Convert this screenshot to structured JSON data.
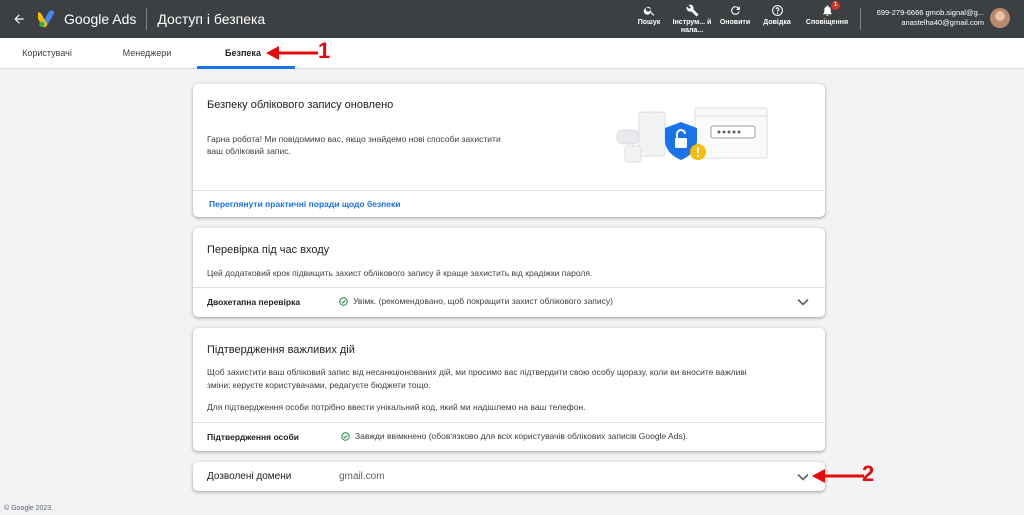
{
  "header": {
    "back_icon": "arrow-back-icon",
    "app_name": "Google Ads",
    "page_title": "Доступ і безпека",
    "tools": [
      {
        "label": "Пошук",
        "icon": "search-icon"
      },
      {
        "label": "Інструм... й нала...",
        "icon": "wrench-icon"
      },
      {
        "label": "Оновити",
        "icon": "refresh-icon"
      },
      {
        "label": "Довідка",
        "icon": "help-icon"
      },
      {
        "label": "Сповіщення",
        "icon": "bell-icon",
        "badge": "1"
      }
    ],
    "account": {
      "line1": "699-279-6666 gmob.signal@g...",
      "line2": "anastelha40@gmail.com"
    }
  },
  "tabs": [
    {
      "label": "Користувачі",
      "active": false
    },
    {
      "label": "Менеджери",
      "active": false
    },
    {
      "label": "Безпека",
      "active": true
    }
  ],
  "cards": {
    "updated": {
      "title": "Безпеку облікового запису оновлено",
      "text_line1": "Гарна робота! Ми повідомимо вас, якщо знайдемо нові способи захистити",
      "text_line2": "ваш обліковий запис.",
      "link": "Переглянути практичні поради щодо безпеки"
    },
    "login_check": {
      "title": "Перевірка під час входу",
      "text": "Цей додатковий крок підвищить захист облікового запису й краще захистить від крадіжки пароля.",
      "row_label": "Двохетапна перевірка",
      "row_status": "Увімк. (рекомендовано, щоб покращити захист облікового запису)"
    },
    "important_actions": {
      "title": "Підтвердження важливих дій",
      "text_line1": "Щоб захистити ваш обліковий запис від несанкціонованих дій, ми просимо вас підтвердити свою особу щоразу, коли ви вносите важливі",
      "text_line2": "зміни: керуєте користувачами, редагуєте бюджети тощо.",
      "text_line3": "Для підтвердження особи потрібно ввести унікальний код, який ми надішлемо на ваш телефон.",
      "row_label": "Підтвердження особи",
      "row_status": "Завжди ввімкнено (обов'язково для всіх користувачів облікових записів Google Ads)."
    },
    "domains": {
      "label": "Дозволені домени",
      "value": "gmail.com"
    }
  },
  "annotations": [
    {
      "number": "1",
      "color": "#e30b0b"
    },
    {
      "number": "2",
      "color": "#e30b0b"
    }
  ],
  "footer": "© Google 2023."
}
